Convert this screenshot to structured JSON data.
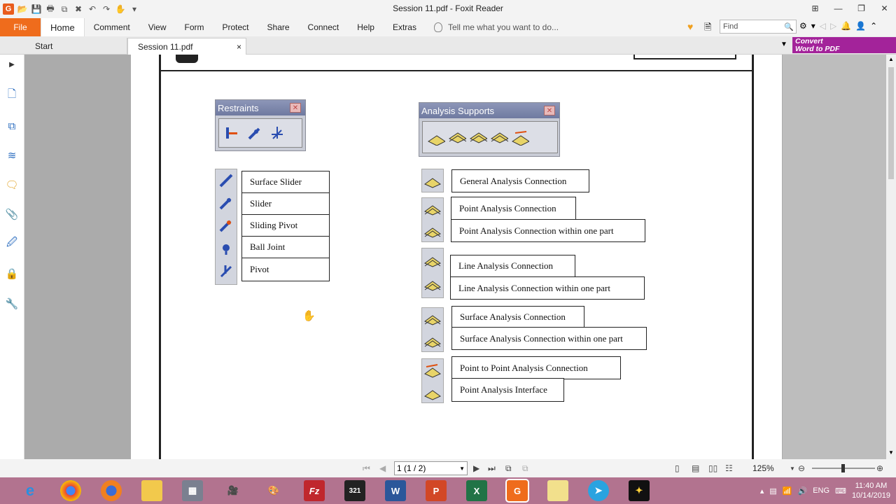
{
  "window": {
    "title": "Session 11.pdf - Foxit Reader"
  },
  "ribbon": {
    "file": "File",
    "tabs": [
      "Home",
      "Comment",
      "View",
      "Form",
      "Protect",
      "Share",
      "Connect",
      "Help",
      "Extras"
    ],
    "tell_me": "Tell me what you want to do...",
    "find_placeholder": "Find"
  },
  "tabs": {
    "start": "Start",
    "document": "Session 11.pdf",
    "close": "×"
  },
  "convert": {
    "line1": "Convert",
    "line2": "Word to PDF"
  },
  "restraints": {
    "title": "Restraints",
    "items": [
      "Surface Slider",
      "Slider",
      "Sliding Pivot",
      "Ball Joint",
      "Pivot"
    ]
  },
  "analysis": {
    "title": "Analysis Supports",
    "items": [
      "General Analysis Connection",
      "Point Analysis Connection",
      "Point Analysis Connection within one part",
      "Line Analysis Connection",
      "Line Analysis Connection within one part",
      "Surface Analysis Connection",
      "Surface Analysis Connection within one part",
      "Point to Point Analysis Connection",
      "Point Analysis Interface"
    ]
  },
  "status": {
    "page": "1 (1 / 2)",
    "zoom": "125%"
  },
  "taskbar": {
    "lang": "ENG",
    "time": "11:40 AM",
    "date": "10/14/2019"
  },
  "colors": {
    "accent": "#ef6c1c",
    "convert": "#a3239a",
    "taskbar": "#b2738f"
  }
}
